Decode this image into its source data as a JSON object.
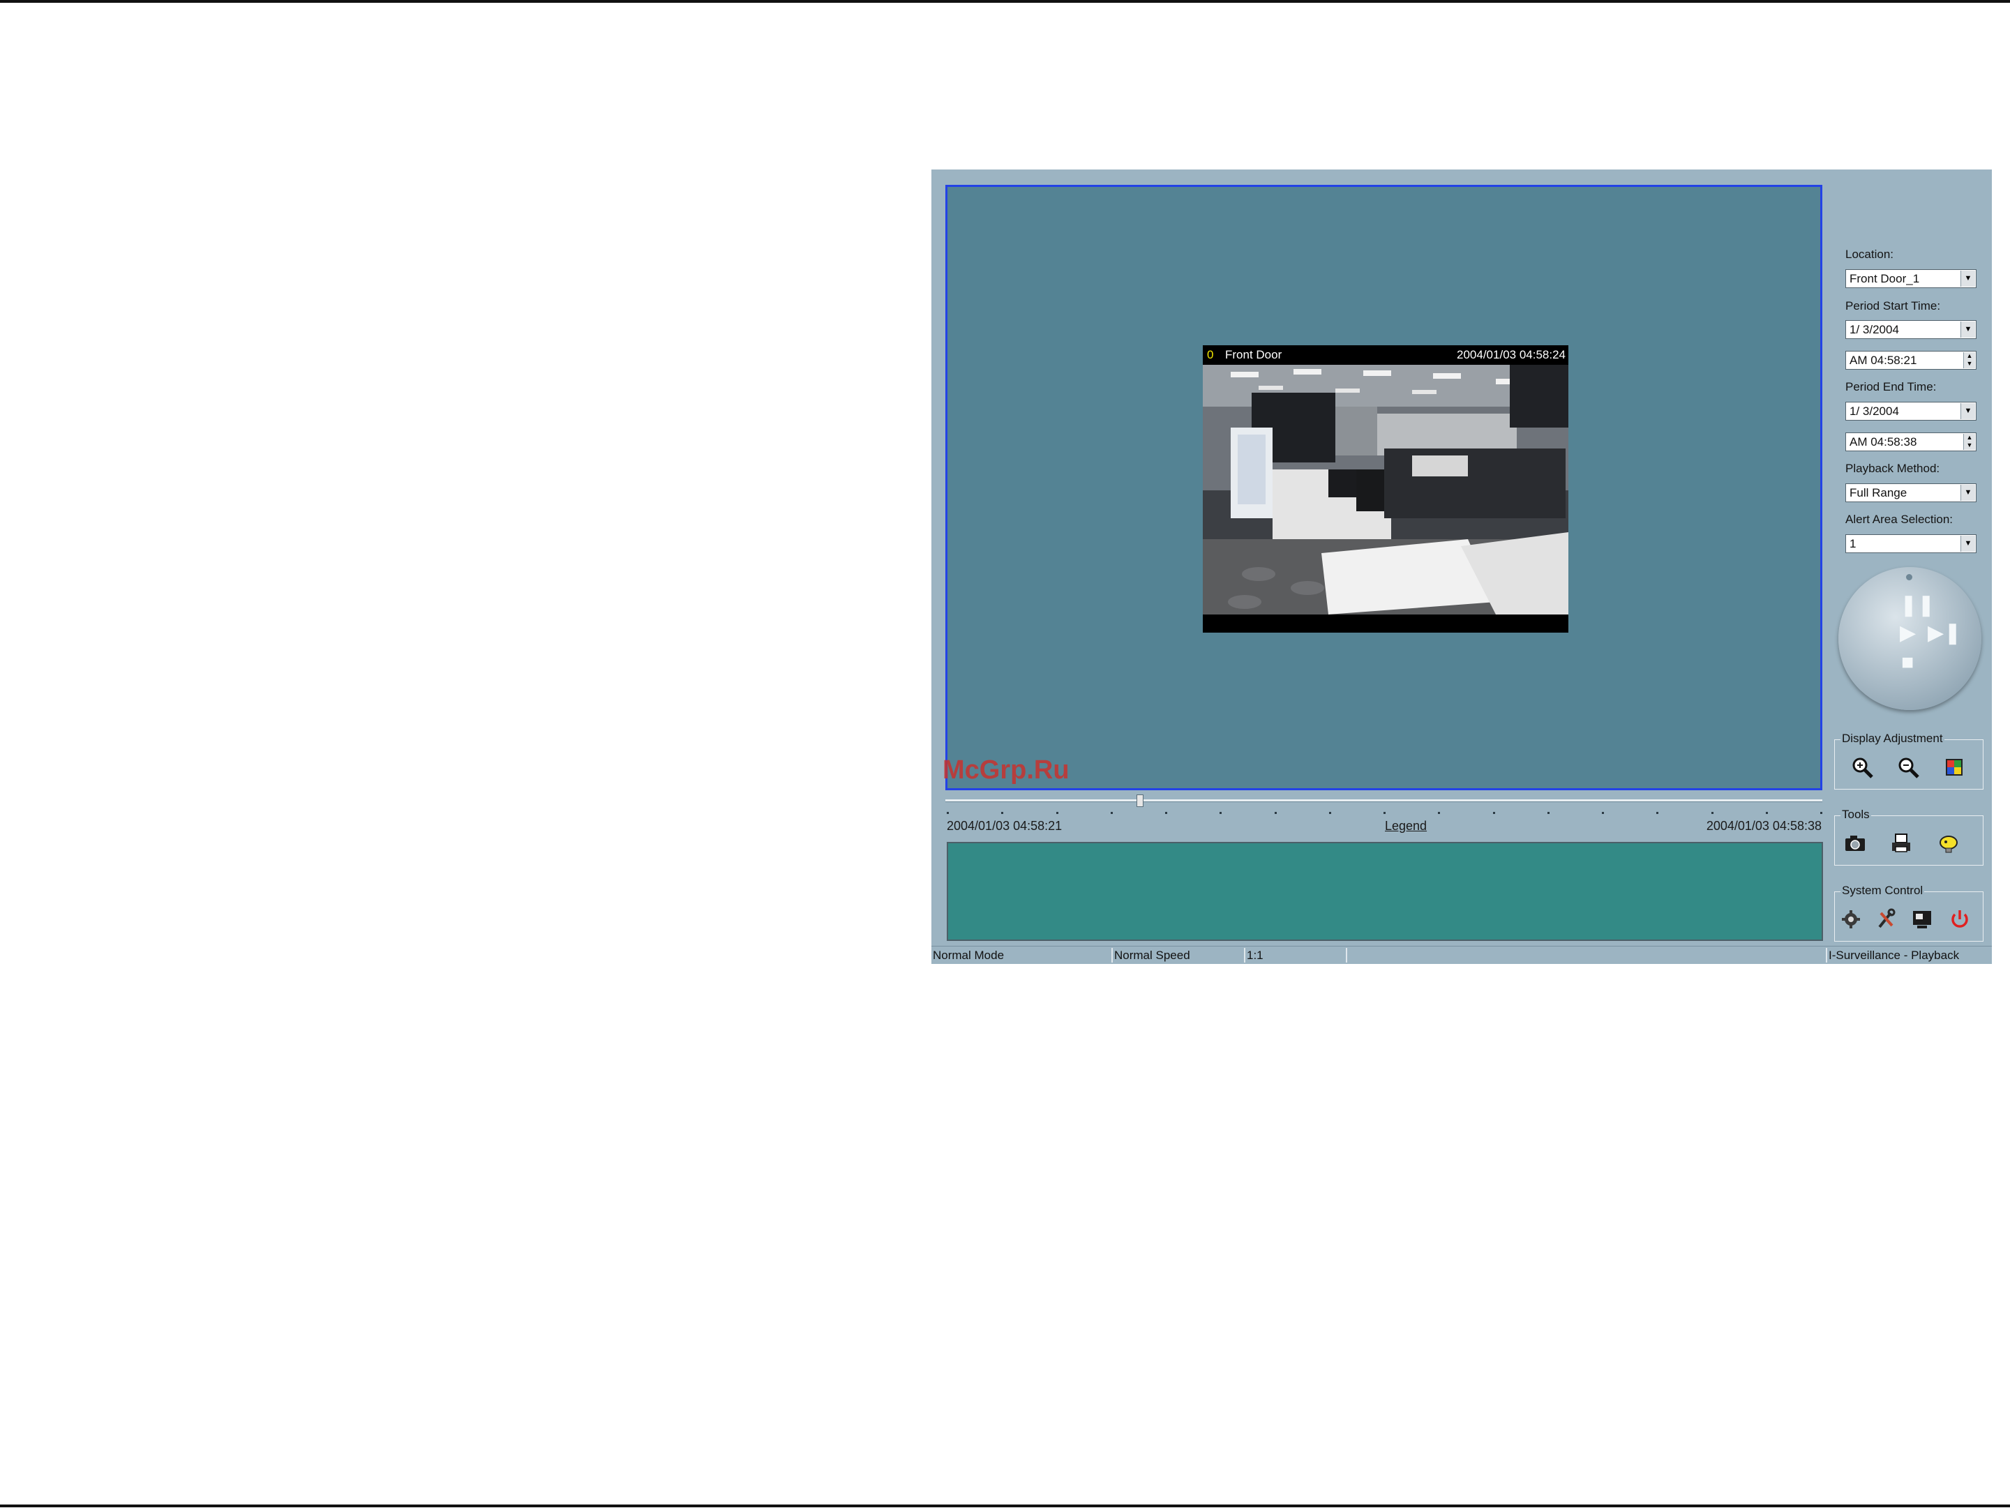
{
  "video": {
    "channel": "0",
    "camera_name": "Front Door",
    "timestamp": "2004/01/03 04:58:24"
  },
  "watermark": "McGrp.Ru",
  "timeline": {
    "start": "2004/01/03 04:58:21",
    "end": "2004/01/03 04:58:38",
    "legend": "Legend",
    "position": 0.22
  },
  "side": {
    "location_label": "Location:",
    "location_value": "Front Door_1",
    "period_start_label": "Period Start Time:",
    "period_start_date": "1/ 3/2004",
    "period_start_time": "AM 04:58:21",
    "period_end_label": "Period End Time:",
    "period_end_date": "1/ 3/2004",
    "period_end_time": "AM 04:58:38",
    "playback_label": "Playback Method:",
    "playback_value": "Full Range",
    "alert_label": "Alert Area Selection:",
    "alert_value": "1"
  },
  "groups": {
    "display": "Display Adjustment",
    "tools": "Tools",
    "system": "System Control"
  },
  "status": {
    "mode": "Normal Mode",
    "speed": "Normal Speed",
    "ratio": "1:1",
    "app": "I-Surveillance - Playback"
  },
  "colors": {
    "panel": "#9cb4c2",
    "video_bg": "#548394",
    "event_panel": "#338a86",
    "power": "#e02020"
  },
  "icons": [
    "zoom-in-icon",
    "zoom-out-icon",
    "color-adjust-icon",
    "snapshot-icon",
    "print-icon",
    "bulb-icon",
    "settings-icon",
    "tools-icon",
    "monitor-icon",
    "power-icon",
    "pause-icon",
    "play-icon",
    "step-forward-icon",
    "stop-icon"
  ]
}
